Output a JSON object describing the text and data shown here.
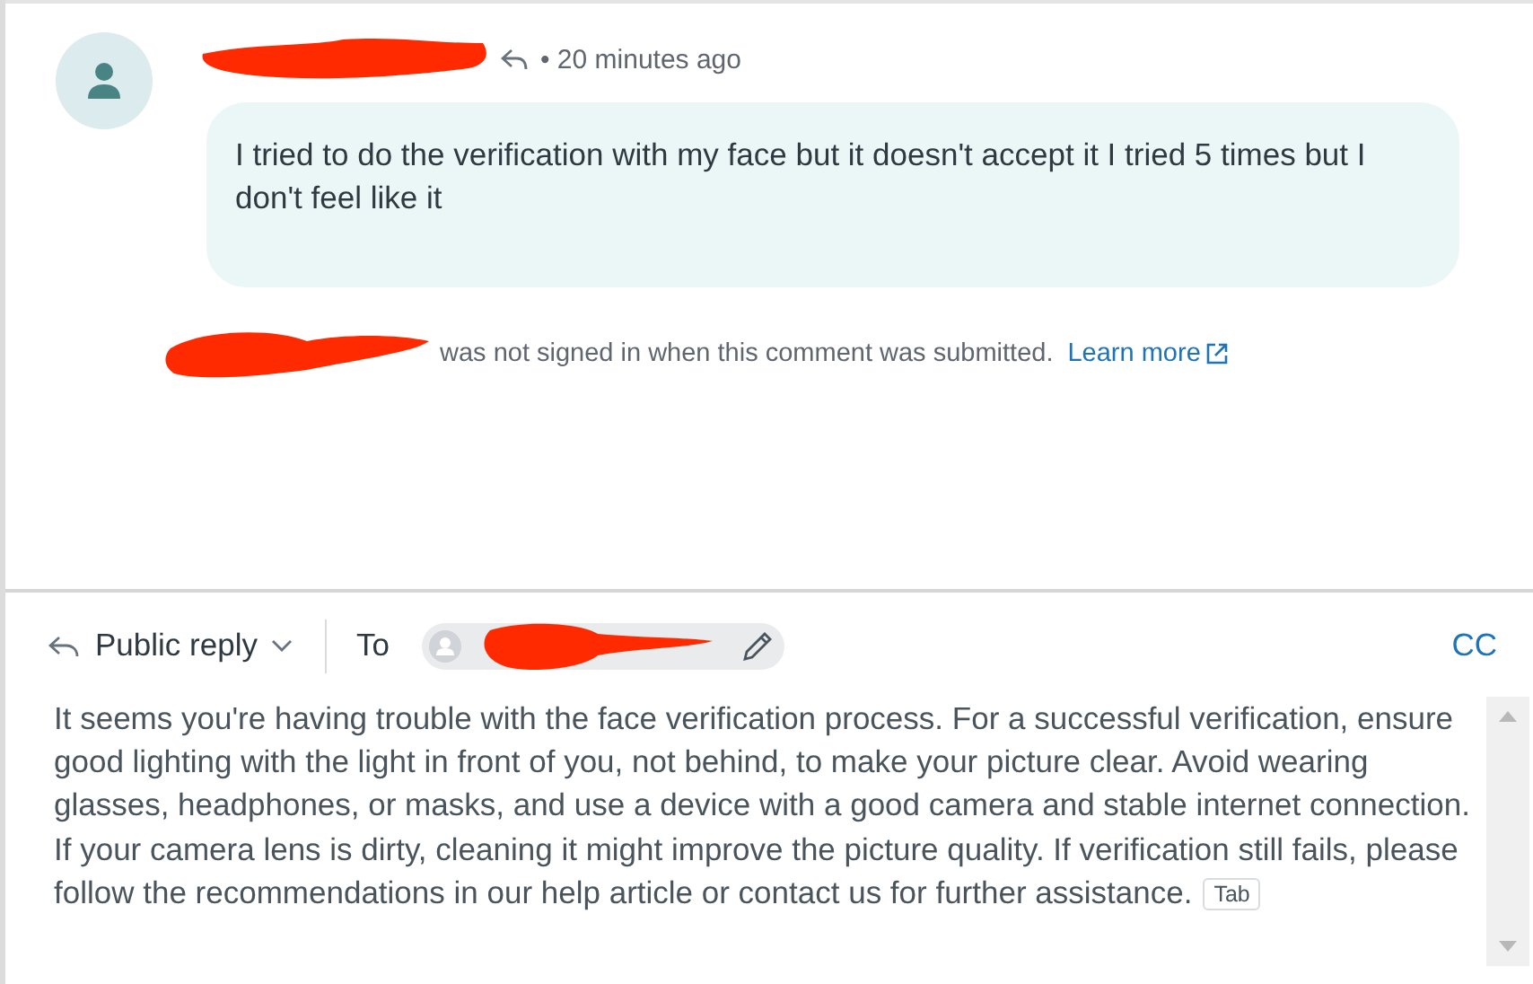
{
  "comment": {
    "time": "• 20 minutes ago",
    "message": "I tried to do the verification with my face but it doesn't accept it I tried 5 times but I don't feel like it",
    "notice": "was not signed in when this comment was submitted.",
    "learn_more": "Learn more"
  },
  "reply": {
    "mode": "Public reply",
    "to_label": "To",
    "cc": "CC",
    "text": "It seems you're having trouble with the face verification process. For a successful verification, ensure good lighting with the light in front of you, not behind, to make your picture clear. Avoid wearing glasses, headphones, or masks, and use a device with a good camera and stable internet connection. If your camera lens is dirty, cleaning it might improve the picture quality. If verification still fails, please follow the recommendations in our help article or contact us for further assistance.",
    "key_hint": "Tab"
  }
}
